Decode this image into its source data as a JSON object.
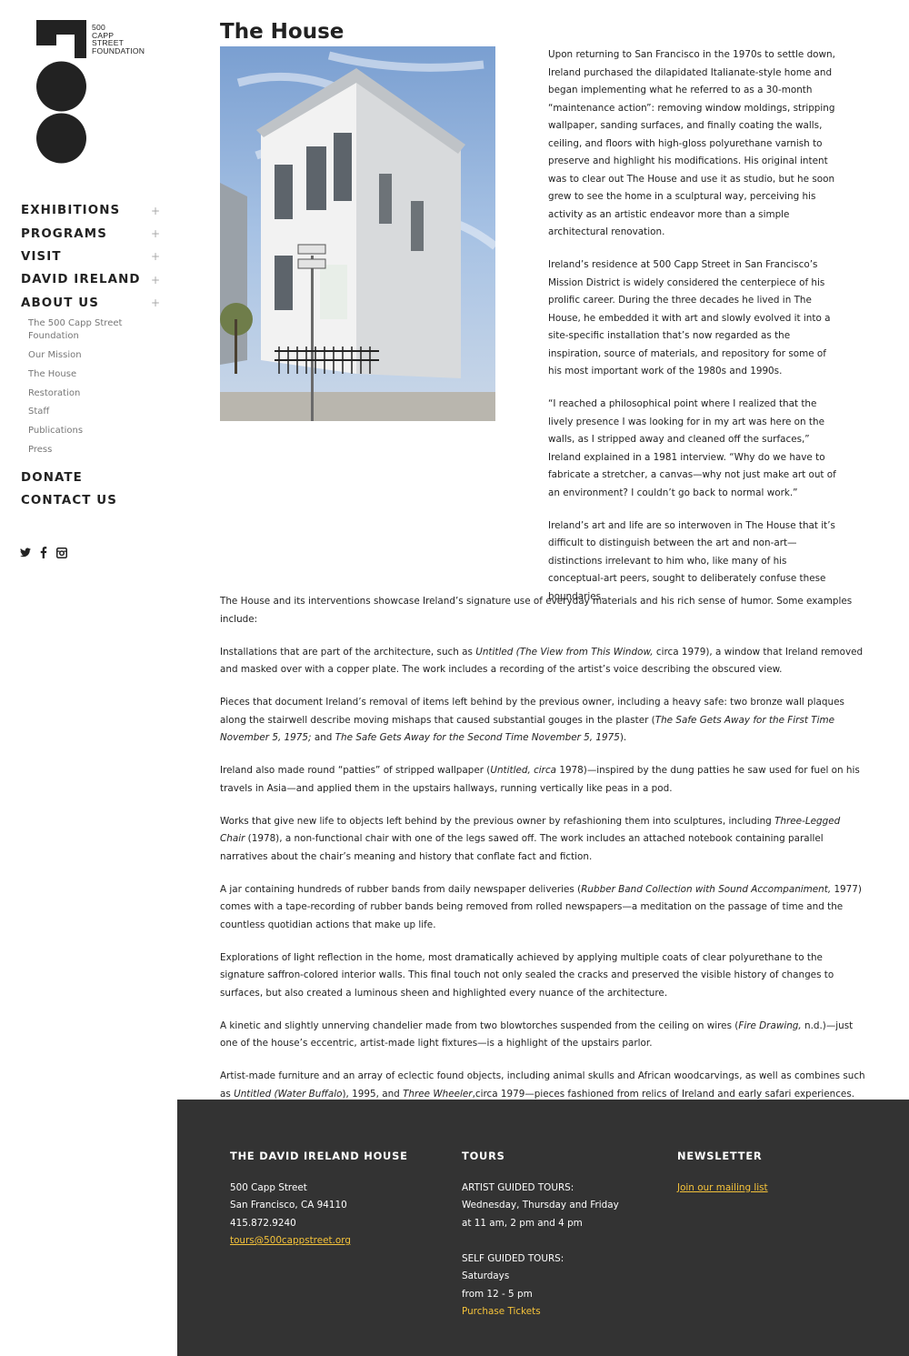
{
  "brand": {
    "logo_lines": [
      "500",
      "CAPP",
      "STREET",
      "FOUNDATION"
    ]
  },
  "nav": {
    "items": [
      {
        "label": "EXHIBITIONS",
        "expander": "+"
      },
      {
        "label": "PROGRAMS",
        "expander": "+"
      },
      {
        "label": "VISIT",
        "expander": "+"
      },
      {
        "label": "DAVID IRELAND",
        "expander": "+"
      },
      {
        "label": "ABOUT US",
        "expander": "+"
      }
    ],
    "about_sub": [
      "The 500 Capp Street Foundation",
      "Our Mission",
      "The House",
      "Restoration",
      "Staff",
      "Publications",
      "Press"
    ],
    "donate": "DONATE",
    "contact": "CONTACT US"
  },
  "social": [
    "twitter-icon",
    "facebook-icon",
    "instagram-icon"
  ],
  "page": {
    "title": "The House",
    "intro": [
      "Upon returning to San Francisco in the 1970s to settle down, Ireland purchased the dilapidated Italianate-style home and began implementing what he referred to as a 30-month “maintenance action”: removing window moldings, stripping wallpaper, sanding surfaces, and finally coating the walls, ceiling, and floors with high-gloss polyurethane varnish to preserve and highlight his modifications. His original intent was to clear out The House and use it as studio, but he soon grew to see the home in a sculptural way, perceiving his activity as an artistic endeavor more than a simple architectural renovation.",
      "Ireland’s residence at 500 Capp Street in San Francisco’s Mission District is widely considered the centerpiece of his prolific career. During the three decades he lived in The House, he embedded it with art and slowly evolved it into a site-specific installation that’s now regarded as the inspiration, source of materials, and repository for some of his most important work of the 1980s and 1990s.",
      "“I reached a philosophical point where I realized that the lively presence I was looking for in my art was here on the walls, as I stripped away and cleaned off the surfaces,” Ireland explained in a 1981 interview. “Why do we have to fabricate a stretcher, a canvas—why not just make art out of an environment? I couldn’t go back to normal work.”",
      "Ireland’s art and life are so interwoven in The House that it’s difficult to distinguish between the art and non-art—distinctions irrelevant to him who, like many of his conceptual-art peers, sought to deliberately confuse these boundaries."
    ],
    "p1": "The House and its interventions showcase Ireland’s signature use of everyday materials and his rich sense of humor. Some examples include:",
    "p2": {
      "a": "Installations that are part of the architecture, such as ",
      "i1": "Untitled (The View from This Window,",
      "b": " circa 1979), a window that Ireland removed and masked over with a copper plate. The work includes a recording of the artist’s voice describing the obscured view."
    },
    "p3": {
      "a": "Pieces that document Ireland’s removal of items left behind by the previous owner, including a heavy safe: two bronze wall plaques along the stairwell describe moving mishaps that caused substantial gouges in the plaster (",
      "i1": "The Safe Gets Away for the First Time November 5, 1975;",
      "b": " and ",
      "i2": "The Safe Gets Away for the Second Time November 5, 1975",
      "c": ")."
    },
    "p4": {
      "a": "Ireland also made round “patties” of stripped wallpaper (",
      "i1": "Untitled, circa",
      "b": " 1978)—inspired by the dung patties he saw used for fuel on his travels in Asia—and applied them in the upstairs hallways, running vertically like peas in a pod."
    },
    "p5": {
      "a": "Works that give new life to objects left behind by the previous owner by refashioning them into sculptures, including ",
      "i1": "Three-Legged Chair",
      "b": " (1978), a non-functional chair with one of the legs sawed off. The work includes an attached notebook containing parallel narratives about the chair’s meaning and history that conflate fact and fiction."
    },
    "p6": {
      "a": "A jar containing hundreds of rubber bands from daily newspaper deliveries (",
      "i1": "Rubber Band Collection with Sound Accompaniment,",
      "b": " 1977) comes with a tape-recording of rubber bands being removed from rolled newspapers—a meditation on the passage of time and the countless quotidian actions that make up life."
    },
    "p7": "Explorations of light reflection in the home, most dramatically achieved by applying multiple coats of clear polyurethane to the signature saffron-colored interior walls. This final touch not only sealed the cracks and preserved the visible history of changes to surfaces, but also created a luminous sheen and highlighted every nuance of the architecture.",
    "p8": {
      "a": "A kinetic and slightly unnerving chandelier made from two blowtorches suspended from the ceiling on wires (",
      "i1": "Fire Drawing,",
      "b": " n.d.)—just one of the house’s eccentric, artist-made light fixtures—is a highlight of the upstairs parlor."
    },
    "p9": {
      "a": "Artist-made furniture and an array of eclectic found objects, including animal skulls and African woodcarvings, as well as combines such as ",
      "i1": "Untitled (Water Buffalo",
      "b": "), 1995, and ",
      "i2": "Three Wheeler",
      "c": ",circa 1979—pieces fashioned from relics of Ireland and early safari experiences."
    }
  },
  "footer": {
    "house": {
      "heading": "THE DAVID IRELAND HOUSE",
      "address1": "500 Capp Street",
      "address2": "San Francisco, CA 94110",
      "phone": "415.872.9240",
      "email": "tours@500cappstreet.org"
    },
    "tours": {
      "heading": "TOURS",
      "guided_label": "ARTIST GUIDED TOURS:",
      "guided_days": "Wednesday, Thursday and Friday",
      "guided_times": "at 11 am, 2 pm and 4 pm",
      "self_label": "SELF GUIDED TOURS:",
      "self_days": "Saturdays",
      "self_times": "from 12 - 5 pm",
      "purchase": "Purchase Tickets"
    },
    "newsletter": {
      "heading": "NEWSLETTER",
      "join": "Join our mailing list"
    }
  },
  "colors": {
    "footer_bg": "#333333",
    "link_yellow": "#f4c23a"
  }
}
